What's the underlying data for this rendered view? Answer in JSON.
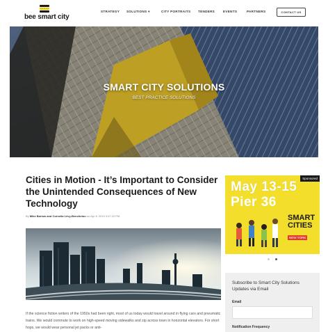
{
  "brand": {
    "name": "bee smart city"
  },
  "nav": {
    "items": [
      {
        "label": "STRATEGY"
      },
      {
        "label": "SOLUTIONS ▾"
      },
      {
        "label": "CITY PORTRAITS"
      },
      {
        "label": "TENDERS"
      },
      {
        "label": "EVENTS"
      },
      {
        "label": "PARTNERS"
      }
    ],
    "contact_label": "CONTACT US"
  },
  "hero": {
    "title": "SMART CITY SOLUTIONS",
    "subtitle": "BEST PRACTICE SOLUTIONS"
  },
  "article": {
    "title": "Cities in Motion - It’s Important to Consider the Unintended Consequences of New Technology",
    "byline_prefix": "By ",
    "authors": "Mike Barlow and Cornelia Lévy-Bencheton",
    "byline_date": " on Apr 8, 2019 3:57:22 PM",
    "body": "If the science fiction writers of the 1950s had been right, most of us today would travel around in flying cars and pneumatic trains. We would commute to work on high-speed moving sidewalks and zip across town in horizontal elevators. For short hops, we would wear personal jet packs or anti-"
  },
  "sidebar": {
    "sponsored_label": "Sponsored",
    "ad": {
      "date_line": "May 13-15",
      "venue_line": "Pier 36",
      "brand_line1": "SMART",
      "brand_line2": "CITIES",
      "brand_line3": "NEW YORK"
    },
    "subscribe": {
      "title": "Subscribe to Smart City Solutions Updates via Email",
      "email_label": "Email",
      "email_value": "",
      "frequency_label": "Notification Frequency"
    }
  },
  "colors": {
    "accent_yellow": "#f3de2c",
    "ad_red": "#e23a2d",
    "text_dark": "#1a1a1a"
  }
}
